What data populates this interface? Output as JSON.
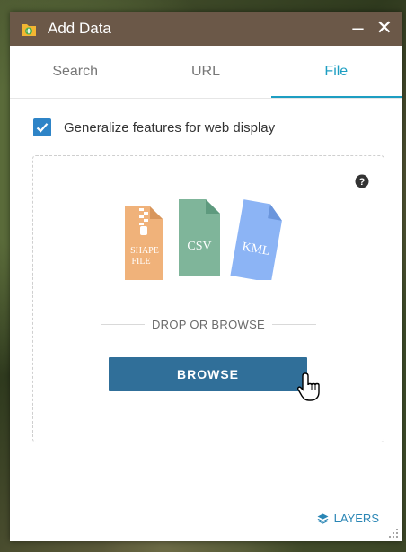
{
  "window": {
    "title": "Add Data",
    "minimize_glyph": "–",
    "close_glyph": "✕"
  },
  "tabs": [
    {
      "label": "Search",
      "active": false
    },
    {
      "label": "URL",
      "active": false
    },
    {
      "label": "File",
      "active": true
    }
  ],
  "options": {
    "generalize_label": "Generalize features for web display",
    "generalize_checked": true
  },
  "dropzone": {
    "file_types": {
      "shapefile_line1": "SHAPE",
      "shapefile_line2": "FILE",
      "csv": "CSV",
      "kml": "KML"
    },
    "divider_text": "DROP OR BROWSE",
    "browse_label": "BROWSE"
  },
  "footer": {
    "layers_label": "LAYERS"
  },
  "colors": {
    "titlebar": "#6b5848",
    "accent": "#1d9ec2",
    "browse_button": "#306f99",
    "checkbox": "#2e84c7",
    "shapefile": "#f0b27a",
    "csv": "#7fb59a",
    "kml": "#8cb4f5"
  },
  "icons": [
    "add-data-app-icon",
    "minimize-icon",
    "close-icon",
    "checkmark-icon",
    "help-icon",
    "shapefile-icon",
    "csv-icon",
    "kml-icon",
    "hand-cursor-icon",
    "layers-icon",
    "resize-grip-icon"
  ]
}
